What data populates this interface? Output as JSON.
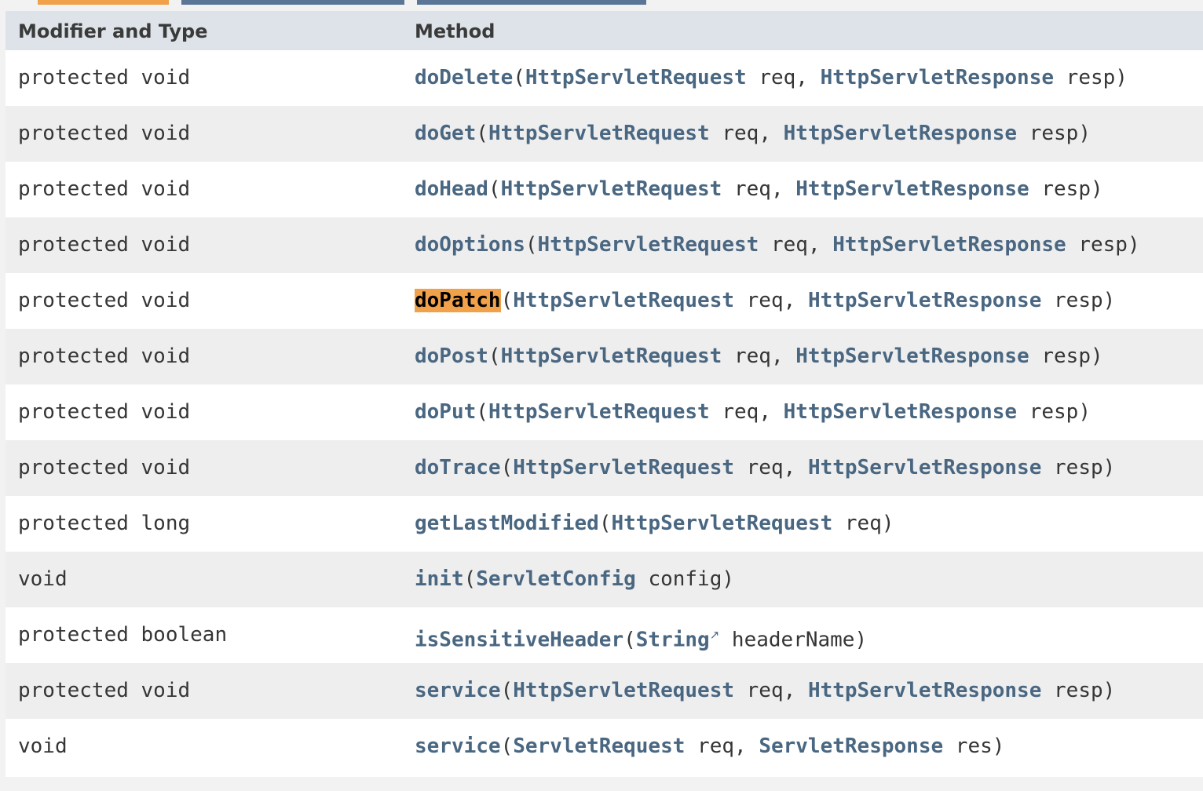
{
  "header": {
    "col_type": "Modifier and Type",
    "col_method": "Method"
  },
  "rows": [
    {
      "type": "protected void",
      "name": "doDelete",
      "p1_type": "HttpServletRequest",
      "p1_name": "req",
      "p2_type": "HttpServletResponse",
      "p2_name": "resp"
    },
    {
      "type": "protected void",
      "name": "doGet",
      "p1_type": "HttpServletRequest",
      "p1_name": "req",
      "p2_type": "HttpServletResponse",
      "p2_name": "resp"
    },
    {
      "type": "protected void",
      "name": "doHead",
      "p1_type": "HttpServletRequest",
      "p1_name": "req",
      "p2_type": "HttpServletResponse",
      "p2_name": "resp"
    },
    {
      "type": "protected void",
      "name": "doOptions",
      "p1_type": "HttpServletRequest",
      "p1_name": "req",
      "p2_type": "HttpServletResponse",
      "p2_name": "resp"
    },
    {
      "type": "protected void",
      "name": "doPatch",
      "p1_type": "HttpServletRequest",
      "p1_name": "req",
      "p2_type": "HttpServletResponse",
      "p2_name": "resp",
      "highlighted": true
    },
    {
      "type": "protected void",
      "name": "doPost",
      "p1_type": "HttpServletRequest",
      "p1_name": "req",
      "p2_type": "HttpServletResponse",
      "p2_name": "resp"
    },
    {
      "type": "protected void",
      "name": "doPut",
      "p1_type": "HttpServletRequest",
      "p1_name": "req",
      "p2_type": "HttpServletResponse",
      "p2_name": "resp"
    },
    {
      "type": "protected void",
      "name": "doTrace",
      "p1_type": "HttpServletRequest",
      "p1_name": "req",
      "p2_type": "HttpServletResponse",
      "p2_name": "resp"
    },
    {
      "type": "protected long",
      "name": "getLastModified",
      "p1_type": "HttpServletRequest",
      "p1_name": "req"
    },
    {
      "type": "void",
      "name": "init",
      "p1_type": "ServletConfig",
      "p1_name": "config"
    },
    {
      "type": "protected boolean",
      "name": "isSensitiveHeader",
      "p1_type": "String",
      "p1_name": "headerName",
      "p1_external": true
    },
    {
      "type": "protected void",
      "name": "service",
      "p1_type": "HttpServletRequest",
      "p1_name": "req",
      "p2_type": "HttpServletResponse",
      "p2_name": "resp"
    },
    {
      "type": "void",
      "name": "service",
      "p1_type": "ServletRequest",
      "p1_name": "req",
      "p2_type": "ServletResponse",
      "p2_name": "res"
    }
  ],
  "colors": {
    "link": "#4a6782",
    "highlight": "#f0a14a",
    "header_bg": "#dee3e9",
    "tab_active": "#f0a14a",
    "tab_inactive": "#5a7596"
  },
  "icons": {
    "external_link": "external-link-icon"
  }
}
